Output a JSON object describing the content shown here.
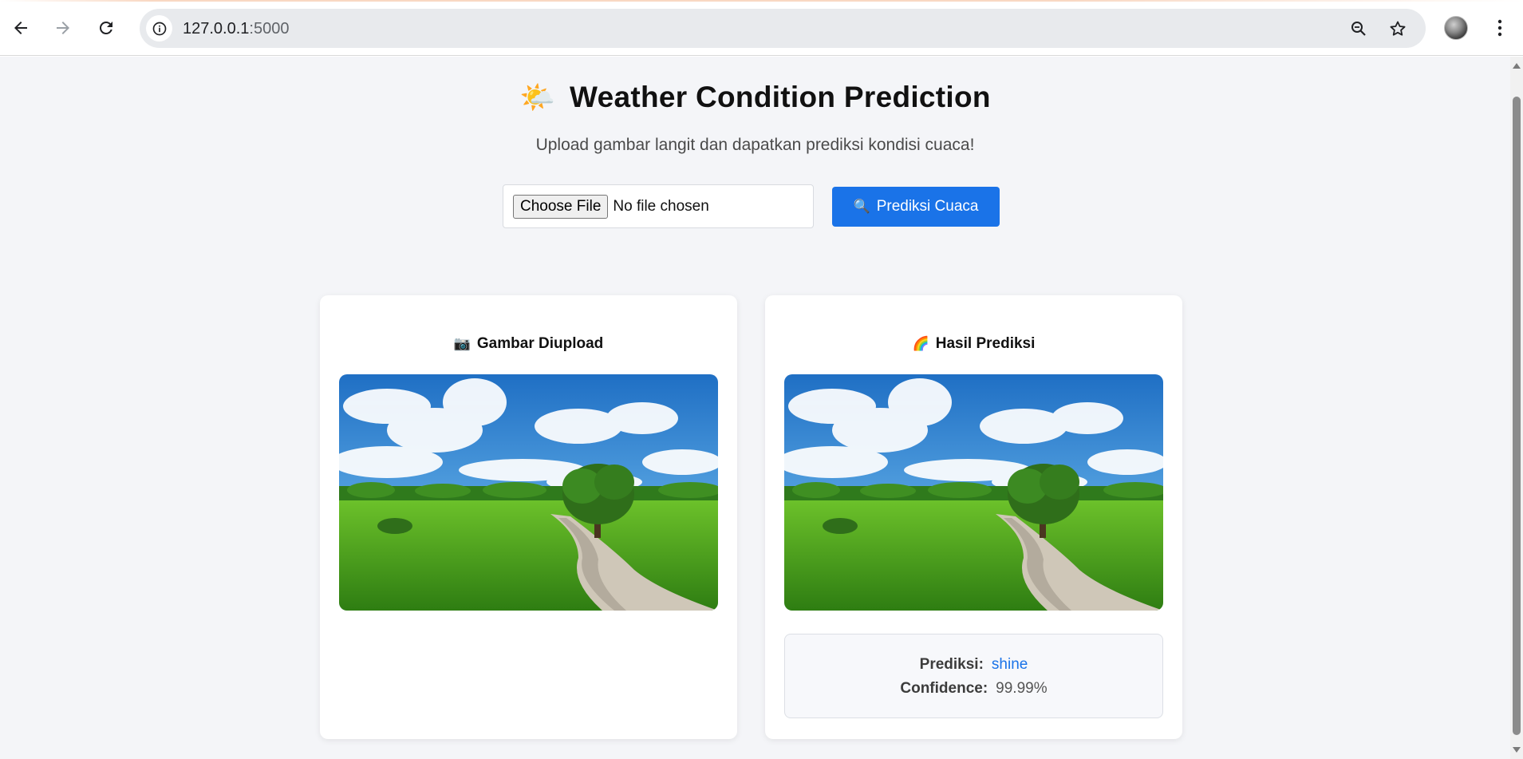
{
  "browser": {
    "url_host": "127.0.0.1",
    "url_port": ":5000",
    "icons": [
      "back-icon",
      "forward-icon",
      "reload-icon",
      "info-icon",
      "zoom-icon",
      "bookmark-star-icon",
      "menu-dots-icon"
    ]
  },
  "page": {
    "title_emoji": "🌤️",
    "title": "Weather Condition Prediction",
    "subtitle": "Upload gambar langit dan dapatkan prediksi kondisi cuaca!",
    "file_input": {
      "button_label": "Choose File",
      "status": "No file chosen"
    },
    "predict_button": {
      "icon": "🔍",
      "label": "Prediksi Cuaca"
    }
  },
  "cards": {
    "uploaded": {
      "emoji": "📷",
      "title": "Gambar Diupload"
    },
    "result": {
      "emoji": "🌈",
      "title": "Hasil Prediksi",
      "prediction_label": "Prediksi:",
      "prediction_value": "shine",
      "confidence_label": "Confidence:",
      "confidence_value": "99.99%"
    }
  },
  "colors": {
    "accent": "#1a73e8",
    "page_bg": "#f4f5f8"
  }
}
